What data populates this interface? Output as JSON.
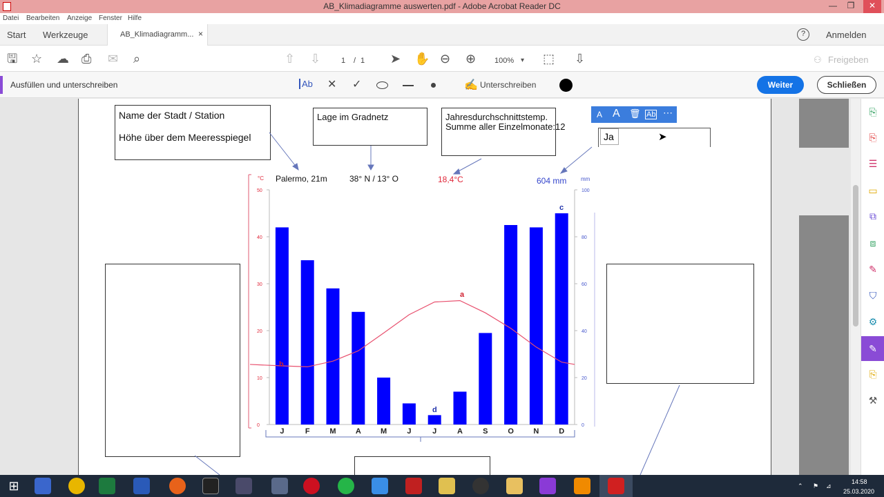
{
  "window": {
    "title": "AB_Klimadiagramme auswerten.pdf - Adobe Acrobat Reader DC"
  },
  "menu": [
    "Datei",
    "Bearbeiten",
    "Anzeige",
    "Fenster",
    "Hilfe"
  ],
  "tabs": {
    "start": "Start",
    "tools": "Werkzeuge",
    "doc": "AB_Klimadiagramm...",
    "close": "×",
    "login": "Anmelden"
  },
  "toolbar": {
    "page_current": "1",
    "page_sep": "/",
    "page_total": "1",
    "zoom": "100%",
    "share": "Freigeben"
  },
  "signbar": {
    "title": "Ausfüllen und unterschreiben",
    "text_tool": "Ab",
    "sign": "Unterschreiben",
    "next": "Weiter",
    "close": "Schließen"
  },
  "doc": {
    "box_name": "Name der Stadt / Station",
    "box_height": "Höhe über dem Meeresspiegel",
    "box_lage": "Lage im Gradnetz",
    "box_temp1": "Jahresdurchschnittstemp.",
    "box_temp2": "Summe aller Einzelmonate:12",
    "input_text": "Ja",
    "station": "Palermo, 21m",
    "coords": "38° N / 13° O",
    "avg_temp": "18,4°C",
    "precip": "604 mm",
    "unit_c": "°C",
    "unit_mm": "mm"
  },
  "colors": {
    "bars": "#0000ff",
    "temp": "#e8506e",
    "precip_label": "#3344cc",
    "accent": "#1473e6"
  },
  "chart_data": {
    "type": "bar",
    "categories": [
      "J",
      "F",
      "M",
      "A",
      "M",
      "J",
      "J",
      "A",
      "S",
      "O",
      "N",
      "D"
    ],
    "series": [
      {
        "values": [
          84,
          70,
          58,
          48,
          20,
          9,
          4,
          14,
          39,
          85,
          84,
          90
        ]
      },
      {
        "values": [
          12.5,
          12.3,
          13.5,
          15.7,
          19.5,
          23.4,
          26.1,
          26.4,
          23.8,
          20.5,
          16.5,
          13.3
        ]
      }
    ],
    "y_left": {
      "ticks": [
        "0",
        "10",
        "20",
        "30",
        "40",
        "50"
      ],
      "range": [
        0,
        50
      ]
    },
    "y_right": {
      "ticks": [
        "0",
        "20",
        "40",
        "60",
        "80",
        "100"
      ],
      "range": [
        0,
        100
      ]
    },
    "annotations": [
      "a",
      "b",
      "c",
      "d"
    ]
  },
  "taskbar": {
    "time": "14:58",
    "date": "25.03.2020"
  }
}
